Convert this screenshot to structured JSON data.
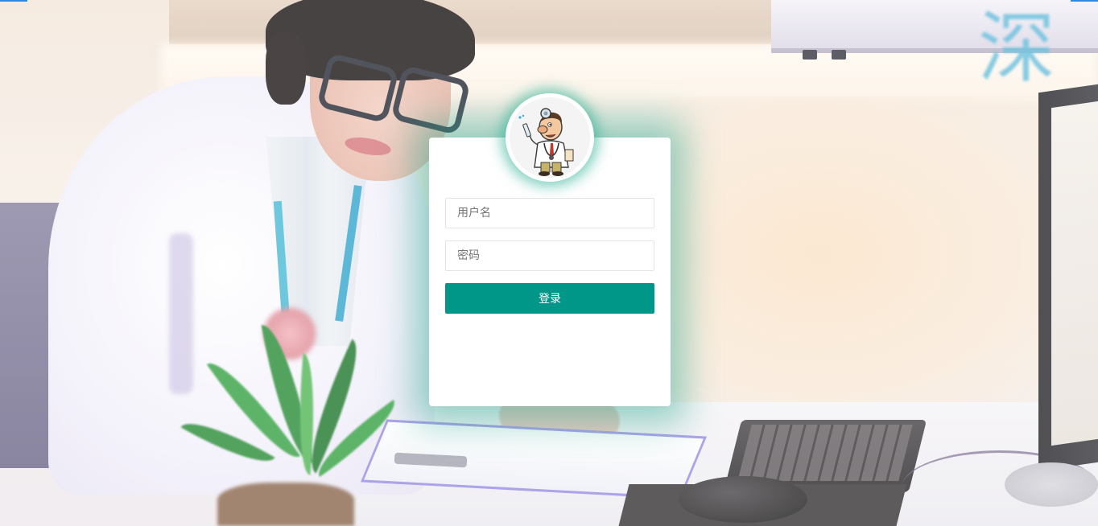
{
  "background": {
    "sign_text": "深"
  },
  "login": {
    "avatar_icon": "doctor-cartoon-icon",
    "username_placeholder": "用户名",
    "password_placeholder": "密码",
    "submit_label": "登录",
    "accent_color": "#009688",
    "glow_color": "#16a085"
  }
}
